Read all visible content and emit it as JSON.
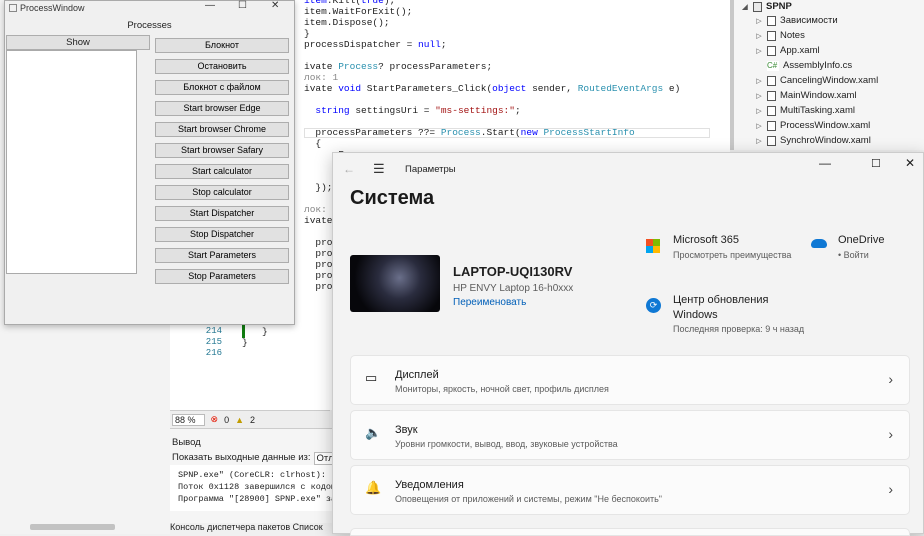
{
  "editor": {
    "code_lines": [
      {
        "html": "<span class='kw'>item</span>.Kill(<span class='kw'>true</span>);"
      },
      {
        "html": "item.WaitForExit();"
      },
      {
        "html": "item.Dispose();"
      },
      {
        "html": "}"
      },
      {
        "html": "processDispatcher = <span class='kw'>null</span>;"
      },
      {
        "html": ""
      },
      {
        "html": "ivate <span class='ty'>Process</span>? processParameters;"
      },
      {
        "html": "<span class='cm'>лок: 1</span>"
      },
      {
        "html": "ivate <span class='kw'>void</span> StartParameters_Click(<span class='kw'>object</span> sender, <span class='ty'>RoutedEventArgs</span> e)"
      },
      {
        "html": ""
      },
      {
        "html": "  <span class='kw'>string</span> settingsUri = <span class='st'>\"ms-settings:\"</span>;"
      },
      {
        "html": ""
      },
      {
        "html": "  processParameters ??= <span class='ty'>Process</span>.Start(<span class='kw'>new</span> <span class='ty'>ProcessStartInfo</span>"
      },
      {
        "html": "  {"
      },
      {
        "html": "      F"
      },
      {
        "html": "      A"
      },
      {
        "html": "      U"
      },
      {
        "html": "  });"
      },
      {
        "html": ""
      },
      {
        "html": "<span class='cm'>лок: 1</span>"
      },
      {
        "html": "ivate vo"
      },
      {
        "html": ""
      },
      {
        "html": "  proce"
      },
      {
        "html": "  proce"
      },
      {
        "html": "  proce"
      },
      {
        "html": "  proce"
      },
      {
        "html": "  proce"
      }
    ],
    "line_numbers": [
      "214",
      "215",
      "216"
    ],
    "closing_lines": [
      "}",
      "}"
    ],
    "zoom": "88 %",
    "errors": "0",
    "warnings": "2"
  },
  "output": {
    "title": "Вывод",
    "source_label": "Показать выходные данные из:",
    "source_value": "Отла",
    "lines": [
      "SPNP.exe\" (CoreCLR: clrhost):",
      "Поток 0x1128 завершился с кодом",
      "Программа \"[28900] SPNP.exe\" за"
    ],
    "bottom_tabs": "Консоль диспетчера пакетов    Список"
  },
  "solution": {
    "project": "SPNP",
    "items": [
      {
        "label": "Зависимости",
        "icon": "dependencies-icon",
        "arrow": "▷"
      },
      {
        "label": "Notes",
        "icon": "folder-icon",
        "arrow": "▷"
      },
      {
        "label": "App.xaml",
        "icon": "xaml-file-icon",
        "arrow": "▷"
      },
      {
        "label": "AssemblyInfo.cs",
        "icon": "csharp-file-icon",
        "arrow": ""
      },
      {
        "label": "CancelingWindow.xaml",
        "icon": "xaml-file-icon",
        "arrow": "▷"
      },
      {
        "label": "MainWindow.xaml",
        "icon": "xaml-file-icon",
        "arrow": "▷"
      },
      {
        "label": "MultiTasking.xaml",
        "icon": "xaml-file-icon",
        "arrow": "▷"
      },
      {
        "label": "ProcessWindow.xaml",
        "icon": "xaml-file-icon",
        "arrow": "▷"
      },
      {
        "label": "SynchroWindow.xaml",
        "icon": "xaml-file-icon",
        "arrow": "▷"
      }
    ]
  },
  "process_window": {
    "title": "ProcessWindow",
    "heading": "Processes",
    "show_button": "Show",
    "buttons": [
      "Блокнот",
      "Остановить",
      "Блокнот с файлом",
      "Start browser Edge",
      "Start browser Chrome",
      "Start browser Safary",
      "Start calculator",
      "Stop calculator",
      "Start Dispatcher",
      "Stop Dispatcher",
      "Start Parameters",
      "Stop Parameters"
    ]
  },
  "settings": {
    "app_title": "Параметры",
    "page_title": "Система",
    "device_name": "LAPTOP-UQI130RV",
    "device_model": "HP ENVY Laptop 16-h0xxx",
    "rename_link": "Переименовать",
    "m365_title": "Microsoft 365",
    "m365_sub": "Просмотреть преимущества",
    "onedrive_title": "OneDrive",
    "onedrive_sub": "• Войти",
    "update_title": "Центр обновления Windows",
    "update_sub": "Последняя проверка: 9 ч назад",
    "cards": [
      {
        "title": "Дисплей",
        "subtitle": "Мониторы, яркость, ночной свет, профиль дисплея",
        "icon": "display-icon"
      },
      {
        "title": "Звук",
        "subtitle": "Уровни громкости, вывод, ввод, звуковые устройства",
        "icon": "sound-icon"
      },
      {
        "title": "Уведомления",
        "subtitle": "Оповещения от приложений и системы, режим \"Не беспокоить\"",
        "icon": "bell-icon"
      }
    ],
    "accent": "#005fb8"
  }
}
